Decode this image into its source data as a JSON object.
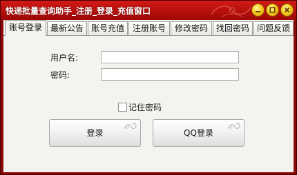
{
  "window": {
    "title": "快递批量查询助手_注册_登录_充值窗口",
    "controls": [
      "minimize-icon",
      "maximize-icon",
      "close-icon"
    ],
    "colors": {
      "titlebar": "#b60f0c",
      "control": "#f6cf1e",
      "client": "#f4f3ef"
    }
  },
  "tabs": [
    {
      "label": "账号登录",
      "active": true
    },
    {
      "label": "最新公告",
      "active": false
    },
    {
      "label": "账号充值",
      "active": false
    },
    {
      "label": "注册账号",
      "active": false
    },
    {
      "label": "修改密码",
      "active": false
    },
    {
      "label": "找回密码",
      "active": false
    },
    {
      "label": "问题反馈",
      "active": false
    }
  ],
  "login": {
    "username_label": "用户名:",
    "username_value": "",
    "password_label": "密码:",
    "password_value": "",
    "remember_label": "记住密码",
    "remember_checked": false,
    "login_button": "登录",
    "qq_login_button": "QQ登录"
  }
}
